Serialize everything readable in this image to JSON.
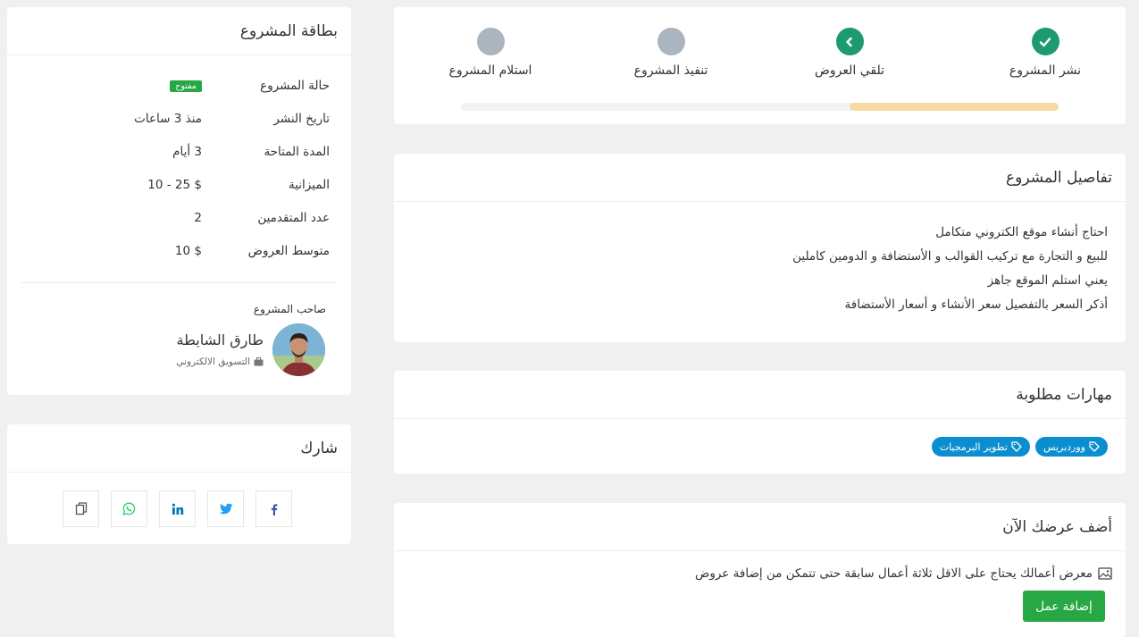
{
  "progress": {
    "steps": [
      {
        "label": "نشر المشروع",
        "state": "done",
        "icon": "check-icon"
      },
      {
        "label": "تلقي العروض",
        "state": "current",
        "icon": "chevron-left-icon"
      },
      {
        "label": "تنفيذ المشروع",
        "state": "pending"
      },
      {
        "label": "استلام المشروع",
        "state": "pending"
      }
    ],
    "fill_percent": 35,
    "fill_color": "#f6d9a5"
  },
  "details": {
    "title": "تفاصيل المشروع",
    "lines": [
      "احتاج أنشاء موقع الكتروني متكامل",
      "للبيع و التجارة مع تركيب القوالب و الأستضافة و الدومين كاملين",
      "يعني استلم الموقع جاهز",
      "أذكر السعر بالتفصيل سعر الأنشاء و أسعار الأستضافة"
    ]
  },
  "skills": {
    "title": "مهارات مطلوبة",
    "tags": [
      {
        "label": "ووردبريس",
        "icon": "tag-icon"
      },
      {
        "label": "تطوير البرمجيات",
        "icon": "tag-icon"
      }
    ]
  },
  "offer": {
    "title": "أضف عرضك الآن",
    "message": "معرض أعمالك يحتاج على الاقل ثلاثة أعمال سابقة حتى تتمكن من إضافة عروض",
    "button": "إضافة عمل"
  },
  "project_card": {
    "title": "بطاقة المشروع",
    "rows": [
      {
        "label": "حالة المشروع",
        "value": "مفتوح"
      },
      {
        "label": "تاريخ النشر",
        "value": "منذ 3 ساعات"
      },
      {
        "label": "المدة المتاحة",
        "value": "3 أيام"
      },
      {
        "label": "الميزانية",
        "value": "$ 25 - 10"
      },
      {
        "label": "عدد المتقدمين",
        "value": "2"
      },
      {
        "label": "متوسط العروض",
        "value": "$ 10"
      }
    ],
    "owner_title": "صاحب المشروع",
    "owner_name": "طارق الشايطة",
    "owner_role": "التسويق الالكتروني"
  },
  "share": {
    "title": "شارك",
    "buttons": [
      {
        "name": "facebook-icon",
        "color": "#3b5998"
      },
      {
        "name": "twitter-icon",
        "color": "#1da1f2"
      },
      {
        "name": "linkedin-icon",
        "color": "#0077b5"
      },
      {
        "name": "whatsapp-icon",
        "color": "#25d366"
      },
      {
        "name": "copy-icon",
        "color": "#555555"
      }
    ]
  },
  "colors": {
    "accent_green": "#1e9a73",
    "button_green": "#28a745",
    "tag_blue": "#0b8ed0",
    "pending_gray": "#aab5bf"
  }
}
